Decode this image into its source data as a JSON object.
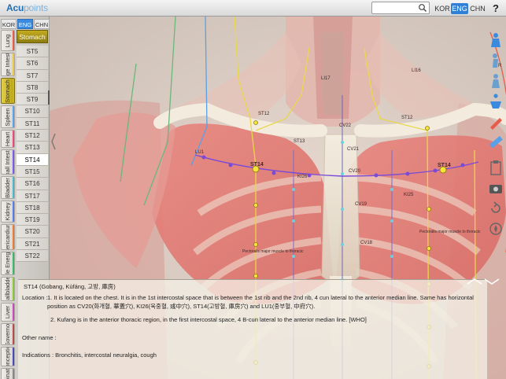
{
  "app": {
    "logo_main": "Acu",
    "logo_sub": "points"
  },
  "header": {
    "lang": [
      "KOR",
      "ENG",
      "CHN"
    ],
    "lang_active": "ENG",
    "help": "?",
    "search_placeholder": ""
  },
  "sidebar": {
    "lang": [
      "KOR",
      "ENG",
      "CHN"
    ],
    "meridians": [
      {
        "label": "Lung",
        "color": "#e85a4a"
      },
      {
        "label": "Large Intestine",
        "color": "#e8c84a"
      },
      {
        "label": "Stomach",
        "color": "#c8b420",
        "active": true
      },
      {
        "label": "Spleen",
        "color": "#5aa0e8"
      },
      {
        "label": "Heart",
        "color": "#e84a7a"
      },
      {
        "label": "Small Intestine",
        "color": "#7a5ae8"
      },
      {
        "label": "Bladder",
        "color": "#4ab8c8"
      },
      {
        "label": "Kidney",
        "color": "#5a7ae8"
      },
      {
        "label": "Pericardium",
        "color": "#e87a3a"
      },
      {
        "label": "Triple Energizer",
        "color": "#3ab86a"
      },
      {
        "label": "Gallbladder",
        "color": "#8ac83a"
      },
      {
        "label": "Liver",
        "color": "#c84ab8"
      },
      {
        "label": "Governor",
        "color": "#b84a4a"
      },
      {
        "label": "Conception",
        "color": "#4a4ab8"
      },
      {
        "label": "Combination",
        "color": "#888888"
      }
    ],
    "selected_meridian": "Stomach",
    "points": [
      "ST5",
      "ST6",
      "ST7",
      "ST8",
      "ST9",
      "ST10",
      "ST11",
      "ST12",
      "ST13",
      "ST14",
      "ST15",
      "ST16",
      "ST17",
      "ST18",
      "ST19",
      "ST20",
      "ST21",
      "ST22"
    ],
    "selected_point": "ST14"
  },
  "scene": {
    "labels": [
      {
        "text": "ST14",
        "id": "st14-left"
      },
      {
        "text": "ST14",
        "id": "st14-right"
      },
      {
        "text": "CV20",
        "id": "cv20"
      },
      {
        "text": "CV21",
        "id": "cv21"
      },
      {
        "text": "CV19",
        "id": "cv19"
      },
      {
        "text": "CV18",
        "id": "cv18"
      },
      {
        "text": "ST12",
        "id": "st12l"
      },
      {
        "text": "ST12",
        "id": "st12r"
      },
      {
        "text": "ST13",
        "id": "st13"
      },
      {
        "text": "KI26",
        "id": "ki26"
      },
      {
        "text": "KI25",
        "id": "ki25"
      },
      {
        "text": "LI17",
        "id": "li17"
      },
      {
        "text": "LI16",
        "id": "li16"
      },
      {
        "text": "CV22",
        "id": "cv22"
      },
      {
        "text": "LU1",
        "id": "lu1"
      }
    ],
    "muscle_caption": "Pectoralis major muscle to thoracic"
  },
  "info": {
    "title": "ST14 (Gobang, Kùfáng, 고방, 庫房)",
    "location_label": "Location :",
    "location_1": "1. It is located on the chest. It is in the 1st intercostal space that is between the 1st rib and the 2nd rib, 4 cun lateral to the anterior median line. Same has horizontal position as CV20(화개혈, 華蓋穴), KI26(욱중혈, 彧中穴), ST14(고방혈, 庫房穴) and LU1(중부혈, 中府穴).",
    "location_2": "2. Kufang is in the anterior thoracic region, in the first intercostal space, 4 B-cun lateral to the anterior median line. [WHO]",
    "other_name": "Other name :",
    "indications": "Indications : Bronchitis, intercostal neuralgia, cough"
  },
  "tools": [
    "front-body-icon",
    "side-body-icon",
    "back-body-icon",
    "full-body-icon",
    "pen-icon",
    "ruler-icon",
    "clipboard-icon",
    "camera-icon",
    "reset-icon",
    "compass-icon"
  ]
}
